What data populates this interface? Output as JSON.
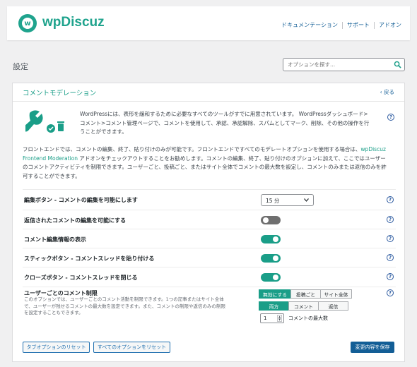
{
  "header": {
    "brand": "wpDiscuz",
    "logo_letter": "w",
    "brand_color": "#1fa38d",
    "links": [
      "ドキュメンテーション",
      "サポート",
      "アドオン"
    ]
  },
  "page": {
    "title": "設定",
    "search_placeholder": "オプションを探す..."
  },
  "panel": {
    "title": "コメントモデレーション",
    "back_label": "戻る",
    "description_1": "WordPressには、表形を緩和するために必要なすべてのツールがすでに用意されています。 WordPressダッシュボード>コメント>コメント管理ページで、コメントを使用して、承認、承認解除、スパムとしてマーク、削除、その他の操作を行うことができます。",
    "description_2a": "フロントエンドでは、コメントの編集、終了、貼り付けのみが可能です。フロントエンドですべてのモデレートオプションを使用する場合は、",
    "description_2_link": "wpDiscuz Frontend Moderation",
    "description_2b": " アドオンをチェックアウトすることをお勧めします。コメントの編集、終了、貼り付けのオプションに加えて、ここではユーザーのコメントアクティビティを制限できます。ユーザーごと、投稿ごと、またはサイト全体でコメントの最大数を設定し、コメントのみまたは返信のみを許可することができます。"
  },
  "settings": {
    "edit_button": {
      "label": "編集ボタン - コメントの編集を可能にします",
      "value": "15 分"
    },
    "edit_replied": {
      "label": "返信されたコメントの編集を可能にする",
      "enabled": false
    },
    "edit_info": {
      "label": "コメント編集情報の表示",
      "enabled": true
    },
    "sticky": {
      "label": "スティックボタン - コメントスレッドを貼り付ける",
      "enabled": true
    },
    "close": {
      "label": "クローズボタン - コメントスレッドを閉じる",
      "enabled": true
    },
    "limit": {
      "label": "ユーザーごとのコメント制限",
      "description": "このオプションでは、ユーザーごとのコメント活動を制限できます。1つの記事またはサイト全体で、ユーザーが残せるコメントの最大数を設定できます。また、コメントの制限や返信のみの制限を設定することもできます。",
      "scope_options": [
        "無効にする",
        "投稿ごと",
        "サイト全体"
      ],
      "scope_selected": "無効にする",
      "type_options": [
        "両方",
        "コメント",
        "返信"
      ],
      "type_selected": "両方",
      "max_value": "1",
      "max_label": "コメントの最大数"
    }
  },
  "footer": {
    "reset_tab": "タブオプションのリセット",
    "reset_all": "すべてのオプションをリセット",
    "save": "変更内容を保存"
  },
  "help_glyph": "?",
  "accent_color": "#1a9e88"
}
